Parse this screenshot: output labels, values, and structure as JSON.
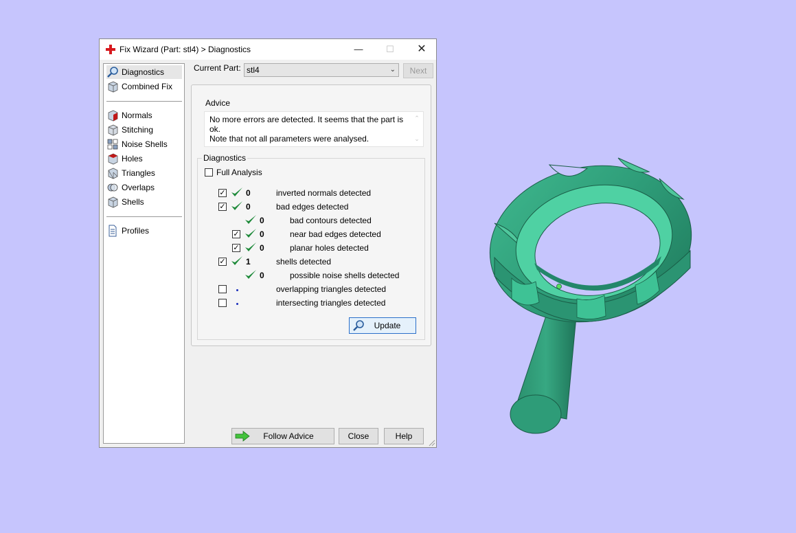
{
  "window": {
    "title": "Fix Wizard (Part: stl4) > Diagnostics",
    "minimize": "—",
    "maximize": "☐",
    "close": "✕"
  },
  "nav": {
    "items": [
      {
        "label": "Diagnostics",
        "icon": "magnifier-icon",
        "selected": true
      },
      {
        "label": "Combined Fix",
        "icon": "cube-icon"
      },
      {
        "label": "Normals",
        "icon": "normals-cube-icon"
      },
      {
        "label": "Stitching",
        "icon": "stitching-cube-icon"
      },
      {
        "label": "Noise Shells",
        "icon": "noise-shells-icon"
      },
      {
        "label": "Holes",
        "icon": "holes-cube-icon"
      },
      {
        "label": "Triangles",
        "icon": "triangles-cube-icon"
      },
      {
        "label": "Overlaps",
        "icon": "overlaps-icon"
      },
      {
        "label": "Shells",
        "icon": "shells-cube-icon"
      },
      {
        "label": "Profiles",
        "icon": "document-icon"
      }
    ]
  },
  "header": {
    "current_part_label": "Current Part:",
    "current_part_value": "stl4",
    "next_label": "Next"
  },
  "advice": {
    "title": "Advice",
    "text_line1": "No more errors are detected. It seems that the part is ok.",
    "text_line2": "Note that not all parameters were analysed."
  },
  "diagnostics": {
    "title": "Diagnostics",
    "full_analysis_label": "Full Analysis",
    "rows": [
      {
        "checked": true,
        "status": "ok",
        "count": "0",
        "label": "inverted normals detected"
      },
      {
        "checked": true,
        "status": "ok",
        "count": "0",
        "label": "bad edges detected"
      },
      {
        "status": "ok",
        "count": "0",
        "label": "bad contours detected"
      },
      {
        "checked": true,
        "status": "ok",
        "count": "0",
        "label": "near bad edges detected"
      },
      {
        "checked": true,
        "status": "ok",
        "count": "0",
        "label": "planar holes detected"
      },
      {
        "checked": true,
        "status": "ok",
        "count": "1",
        "label": "shells detected"
      },
      {
        "status": "ok",
        "count": "0",
        "label": "possible noise shells detected"
      },
      {
        "checked": false,
        "status": "not-run",
        "label": "overlapping triangles detected"
      },
      {
        "checked": false,
        "status": "not-run",
        "label": "intersecting triangles detected"
      }
    ],
    "update_label": "Update"
  },
  "footer": {
    "follow_advice_label": "Follow Advice",
    "close_label": "Close",
    "help_label": "Help"
  },
  "colors": {
    "background": "#c6c5fd",
    "model": "#2e9c78",
    "check_green": "#1e8a3a"
  }
}
